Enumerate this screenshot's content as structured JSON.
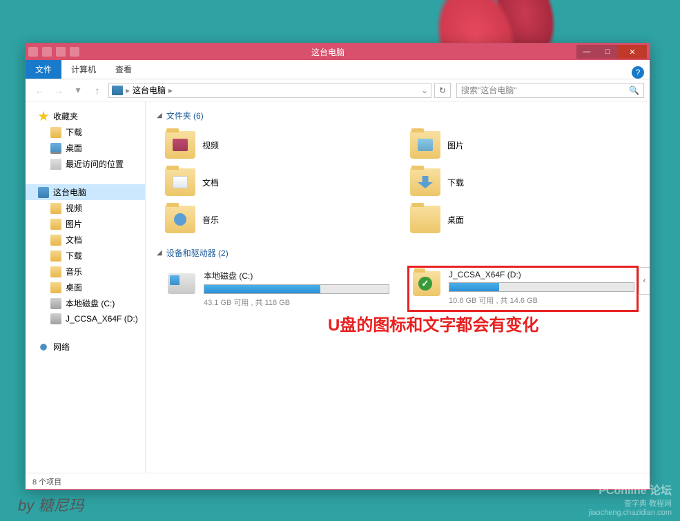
{
  "titlebar": {
    "title": "这台电脑",
    "minimize": "—",
    "maximize": "□",
    "close": "✕"
  },
  "ribbon": {
    "file": "文件",
    "computer": "计算机",
    "view": "查看",
    "help": "?"
  },
  "nav": {
    "back": "←",
    "forward": "→",
    "up": "↑",
    "dropdown": "▾",
    "breadcrumb_text": "这台电脑",
    "breadcrumb_sep": "▸",
    "address_dropdown": "⌄",
    "refresh": "↻",
    "search_placeholder": "搜索\"这台电脑\"",
    "search_icon": "🔍"
  },
  "sidebar": {
    "favorites": {
      "label": "收藏夹",
      "items": [
        {
          "label": "下载",
          "icon": "folder-ic"
        },
        {
          "label": "桌面",
          "icon": "monitor-ic"
        },
        {
          "label": "最近访问的位置",
          "icon": "recent-ic"
        }
      ]
    },
    "thispc": {
      "label": "这台电脑",
      "items": [
        {
          "label": "视频",
          "icon": "folder-ic"
        },
        {
          "label": "图片",
          "icon": "folder-ic"
        },
        {
          "label": "文档",
          "icon": "folder-ic"
        },
        {
          "label": "下载",
          "icon": "folder-ic"
        },
        {
          "label": "音乐",
          "icon": "folder-ic"
        },
        {
          "label": "桌面",
          "icon": "folder-ic"
        },
        {
          "label": "本地磁盘 (C:)",
          "icon": "drive-ic"
        },
        {
          "label": "J_CCSA_X64F (D:)",
          "icon": "drive-ic"
        }
      ]
    },
    "network": {
      "label": "网络"
    }
  },
  "main": {
    "folders_header": "文件夹 (6)",
    "folders": [
      {
        "label": "视频",
        "inner": "bf-video"
      },
      {
        "label": "图片",
        "inner": "bf-pic"
      },
      {
        "label": "文档",
        "inner": "bf-doc"
      },
      {
        "label": "下载",
        "inner": "bf-dl"
      },
      {
        "label": "音乐",
        "inner": "bf-music"
      },
      {
        "label": "桌面",
        "inner": ""
      }
    ],
    "drives_header": "设备和驱动器 (2)",
    "drives": [
      {
        "name": "本地磁盘 (C:)",
        "status": "43.1 GB 可用 , 共 118 GB",
        "fill_pct": 63,
        "highlighted": false,
        "icon": "hdd"
      },
      {
        "name": "J_CCSA_X64F (D:)",
        "status": "10.6 GB 可用 , 共 14.6 GB",
        "fill_pct": 27,
        "highlighted": true,
        "icon": "usb"
      }
    ],
    "chevron": "‹",
    "annotation": "U盘的图标和文字都会有变化"
  },
  "statusbar": {
    "text": "8 个项目"
  },
  "desktop": {
    "attribution": "by 糖尼玛",
    "watermark1": "PConline 论坛",
    "watermark2": "查字典 教程网",
    "watermark3": "jiaocheng.chazidian.com"
  }
}
